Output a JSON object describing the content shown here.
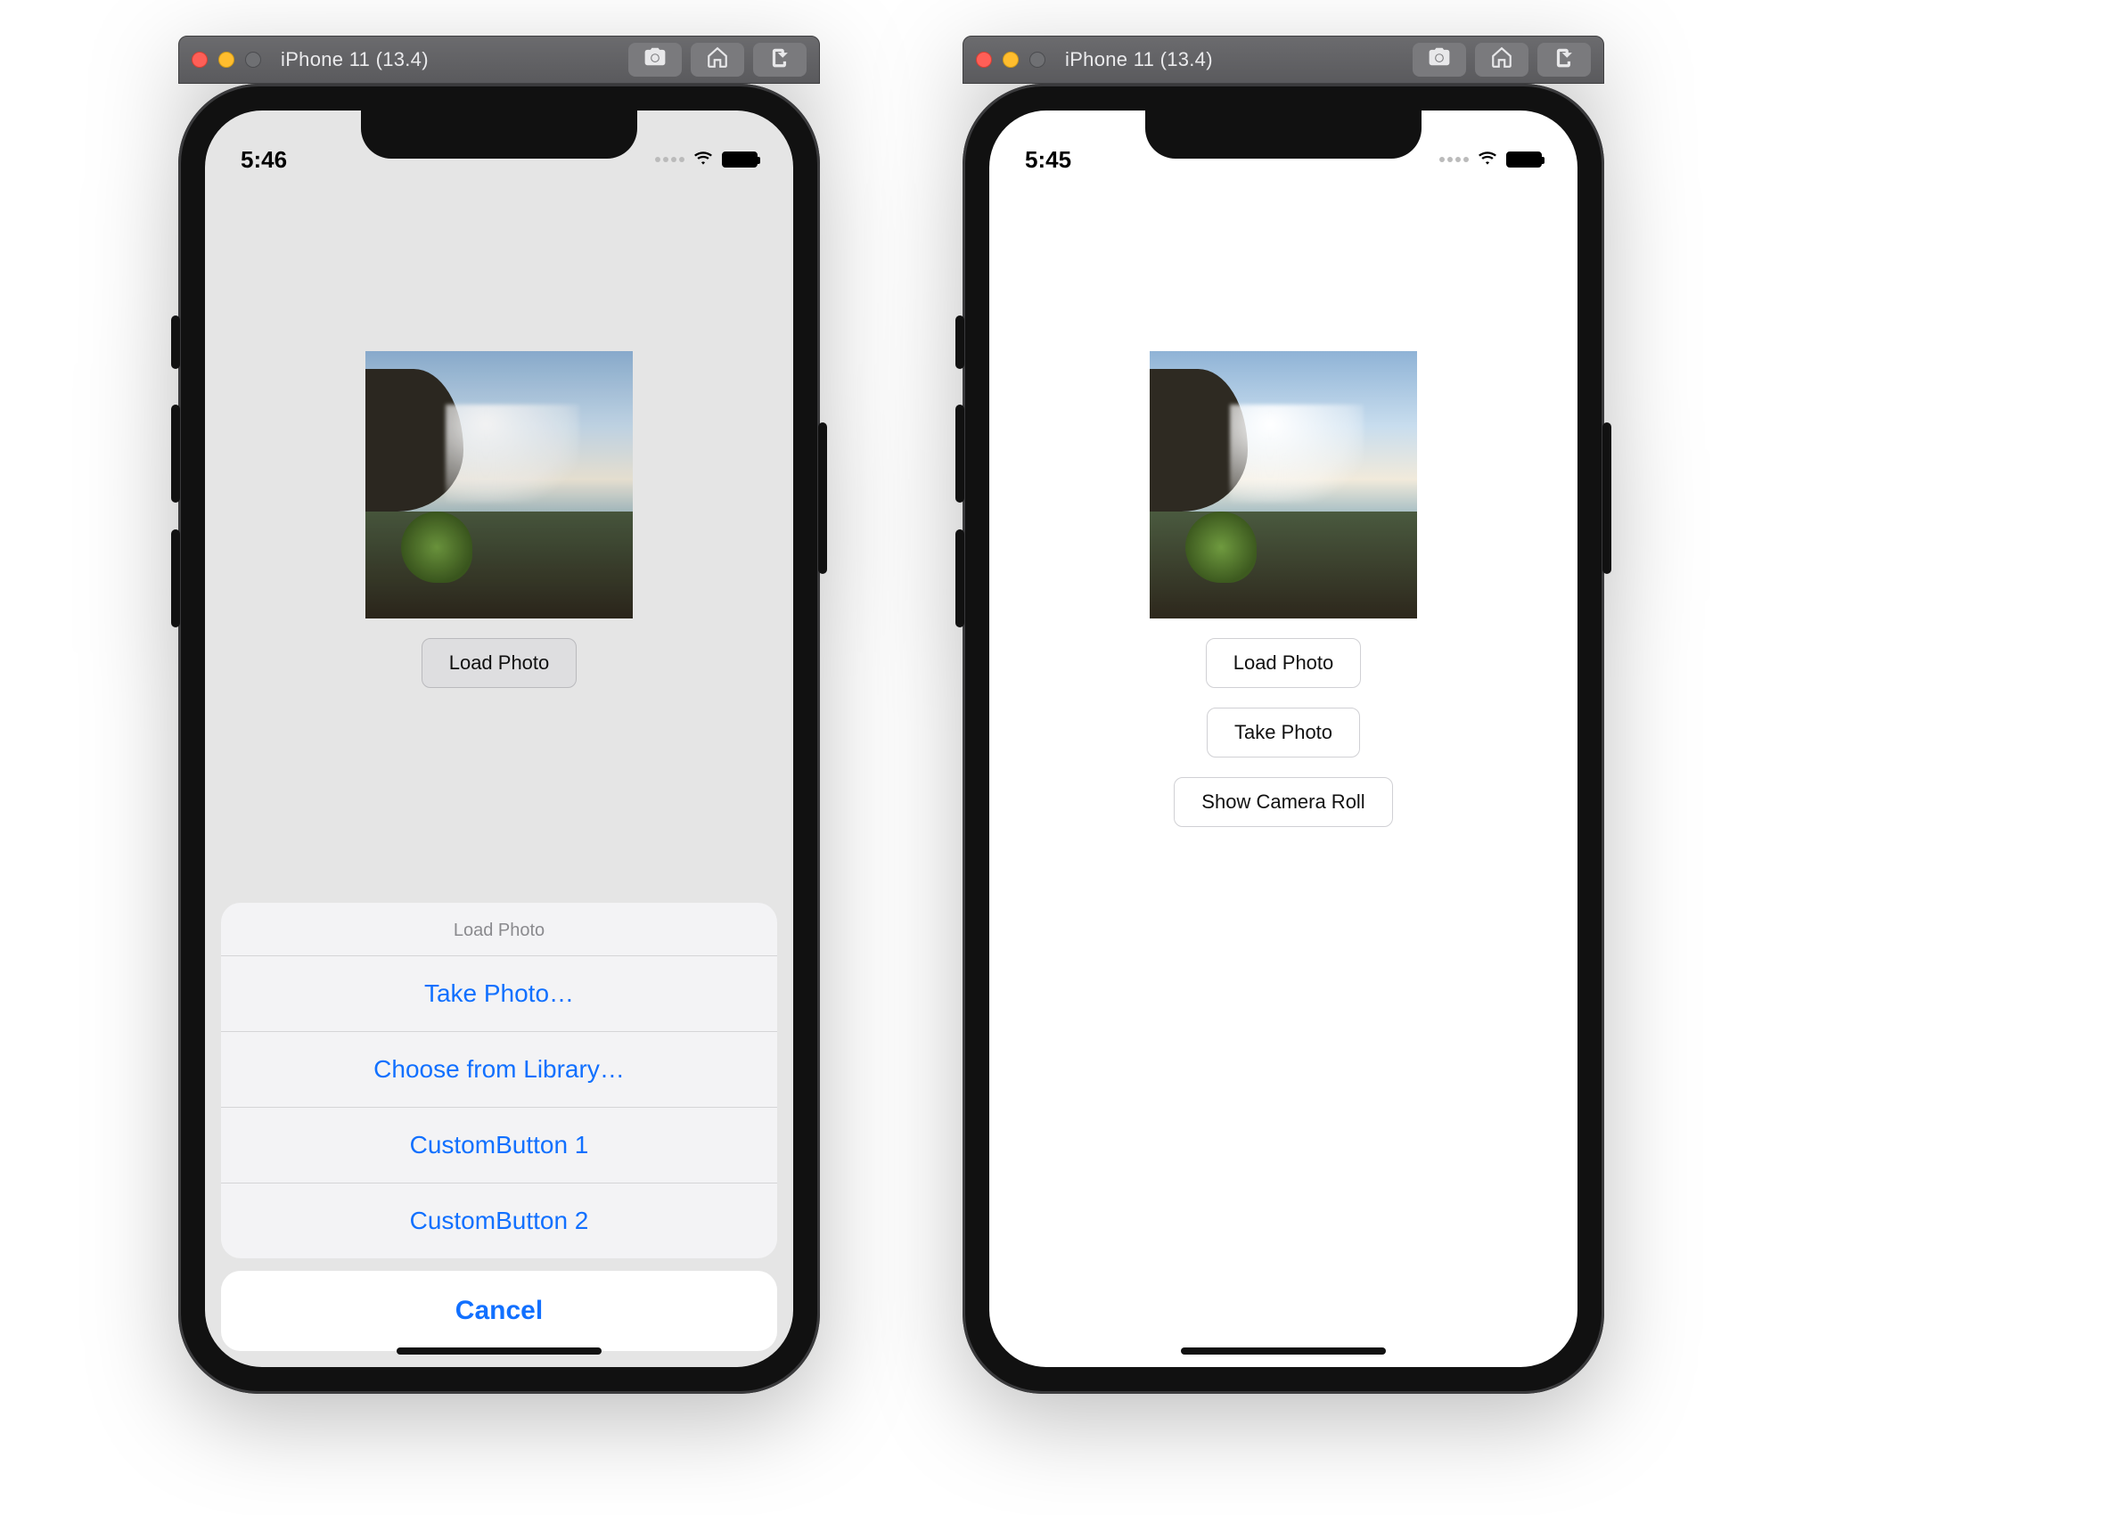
{
  "simulator": {
    "title": "iPhone 11 (13.4)",
    "toolbarIcons": [
      "screenshot-icon",
      "home-icon",
      "rotate-icon"
    ]
  },
  "left": {
    "statusTime": "5:46",
    "app": {
      "loadButton": "Load Photo"
    },
    "sheet": {
      "title": "Load Photo",
      "items": [
        "Take Photo…",
        "Choose from Library…",
        "CustomButton 1",
        "CustomButton 2"
      ],
      "cancel": "Cancel"
    }
  },
  "right": {
    "statusTime": "5:45",
    "app": {
      "buttons": [
        "Load Photo",
        "Take Photo",
        "Show Camera Roll"
      ]
    }
  }
}
